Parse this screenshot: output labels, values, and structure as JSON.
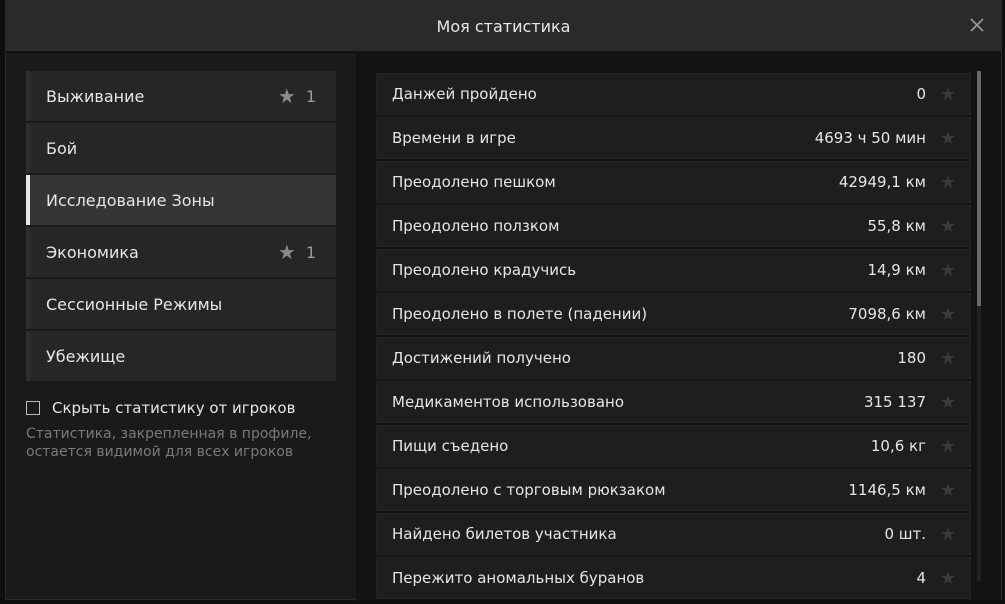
{
  "window": {
    "title": "Моя статистика"
  },
  "sidebar": {
    "items": [
      {
        "label": "Выживание",
        "star": "★",
        "count": "1"
      },
      {
        "label": "Бой",
        "star": "",
        "count": ""
      },
      {
        "label": "Исследование Зоны",
        "star": "",
        "count": ""
      },
      {
        "label": "Экономика",
        "star": "★",
        "count": "1"
      },
      {
        "label": "Сессионные Режимы",
        "star": "",
        "count": ""
      },
      {
        "label": "Убежище",
        "star": "",
        "count": ""
      }
    ],
    "active_index": 2
  },
  "privacy": {
    "checkbox_label": "Скрыть статистику от игроков",
    "checked": false,
    "hint": "Статистика, закрепленная в профиле, остается видимой для всех игроков"
  },
  "stats": [
    {
      "label": "Данжей пройдено",
      "value": "0"
    },
    {
      "label": "Времени в игре",
      "value": "4693 ч 50 мин"
    },
    {
      "label": "Преодолено пешком",
      "value": "42949,1 км"
    },
    {
      "label": "Преодолено ползком",
      "value": "55,8 км"
    },
    {
      "label": "Преодолено крадучись",
      "value": "14,9 км"
    },
    {
      "label": "Преодолено в полете (падении)",
      "value": "7098,6 км"
    },
    {
      "label": "Достижений получено",
      "value": "180"
    },
    {
      "label": "Медикаментов использовано",
      "value": "315 137"
    },
    {
      "label": "Пищи съедено",
      "value": "10,6 кг"
    },
    {
      "label": "Преодолено с торговым рюкзаком",
      "value": "1146,5 км"
    },
    {
      "label": "Найдено билетов участника",
      "value": "0 шт."
    },
    {
      "label": "Пережито аномальных буранов",
      "value": "4"
    }
  ],
  "icons": {
    "close": "close-icon",
    "star": "star-icon"
  },
  "colors": {
    "active_accent": "#e8e8e8",
    "star_inactive": "#3a3a3a",
    "star_sidebar": "#8a8a8a"
  }
}
